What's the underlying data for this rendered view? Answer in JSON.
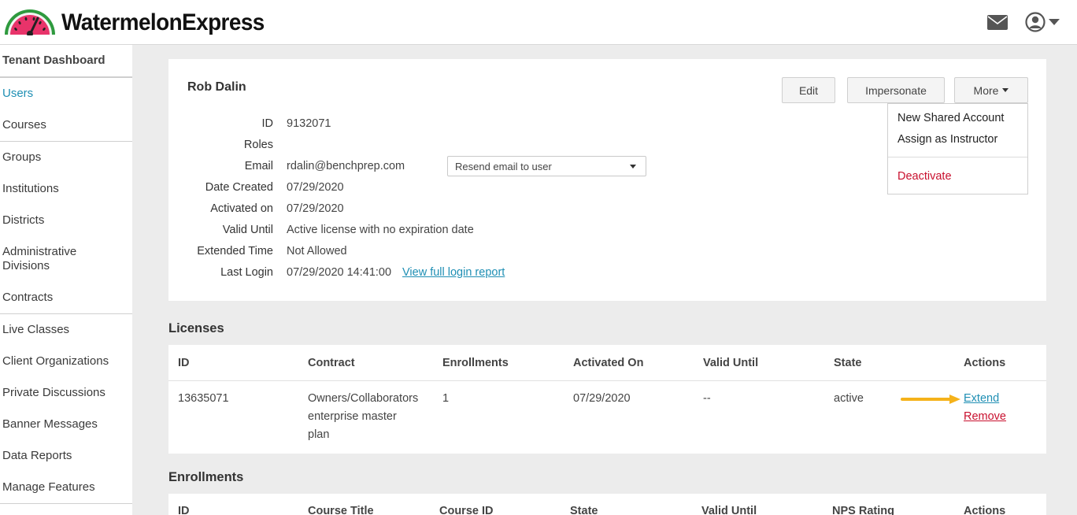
{
  "header": {
    "brand": "WatermelonExpress",
    "icons": [
      "watermelon-logo-icon",
      "mail-icon",
      "user-avatar-icon",
      "caret-down-icon"
    ]
  },
  "sidebar": {
    "items": [
      {
        "label": "Tenant Dashboard"
      },
      {
        "label": "Users"
      },
      {
        "label": "Courses"
      },
      {
        "label": "Groups"
      },
      {
        "label": "Institutions"
      },
      {
        "label": "Districts"
      },
      {
        "label": "Administrative Divisions"
      },
      {
        "label": "Contracts"
      },
      {
        "label": "Live Classes"
      },
      {
        "label": "Client Organizations"
      },
      {
        "label": "Private Discussions"
      },
      {
        "label": "Banner Messages"
      },
      {
        "label": "Data Reports"
      },
      {
        "label": "Manage Features"
      }
    ]
  },
  "user": {
    "name": "Rob Dalin",
    "buttons": {
      "edit": "Edit",
      "impersonate": "Impersonate",
      "more": "More"
    },
    "fields": [
      {
        "label": "ID",
        "value": "9132071"
      },
      {
        "label": "Roles",
        "value": ""
      },
      {
        "label": "Email",
        "value": "rdalin@benchprep.com"
      },
      {
        "label": "Date Created",
        "value": "07/29/2020"
      },
      {
        "label": "Activated on",
        "value": "07/29/2020"
      },
      {
        "label": "Valid Until",
        "value": "Active license with no expiration date"
      },
      {
        "label": "Extended Time",
        "value": "Not Allowed"
      },
      {
        "label": "Last Login",
        "value": "07/29/2020 14:41:00"
      }
    ],
    "login_report_link": "View full login report",
    "email_action_select": "Resend email to user"
  },
  "more_menu": {
    "items": [
      "New Shared Account",
      "Assign as Instructor"
    ],
    "danger_item": "Deactivate"
  },
  "licenses": {
    "title": "Licenses",
    "columns": [
      "ID",
      "Contract",
      "Enrollments",
      "Activated On",
      "Valid Until",
      "State",
      "Actions"
    ],
    "rows": [
      {
        "id": "13635071",
        "contract": [
          "Owners/Collaborators",
          "enterprise master",
          "plan"
        ],
        "enrollments": "1",
        "activated_on": "07/29/2020",
        "valid_until": "--",
        "state": "active",
        "actions": [
          "Extend",
          "Remove"
        ]
      }
    ]
  },
  "enrollments": {
    "title": "Enrollments",
    "columns": [
      "ID",
      "Course Title",
      "Course ID",
      "State",
      "Valid Until",
      "NPS Rating",
      "Actions"
    ]
  },
  "colors": {
    "accent": "#1f8fb4",
    "danger": "#c8102e",
    "highlight_arrow": "#f5b21a"
  }
}
